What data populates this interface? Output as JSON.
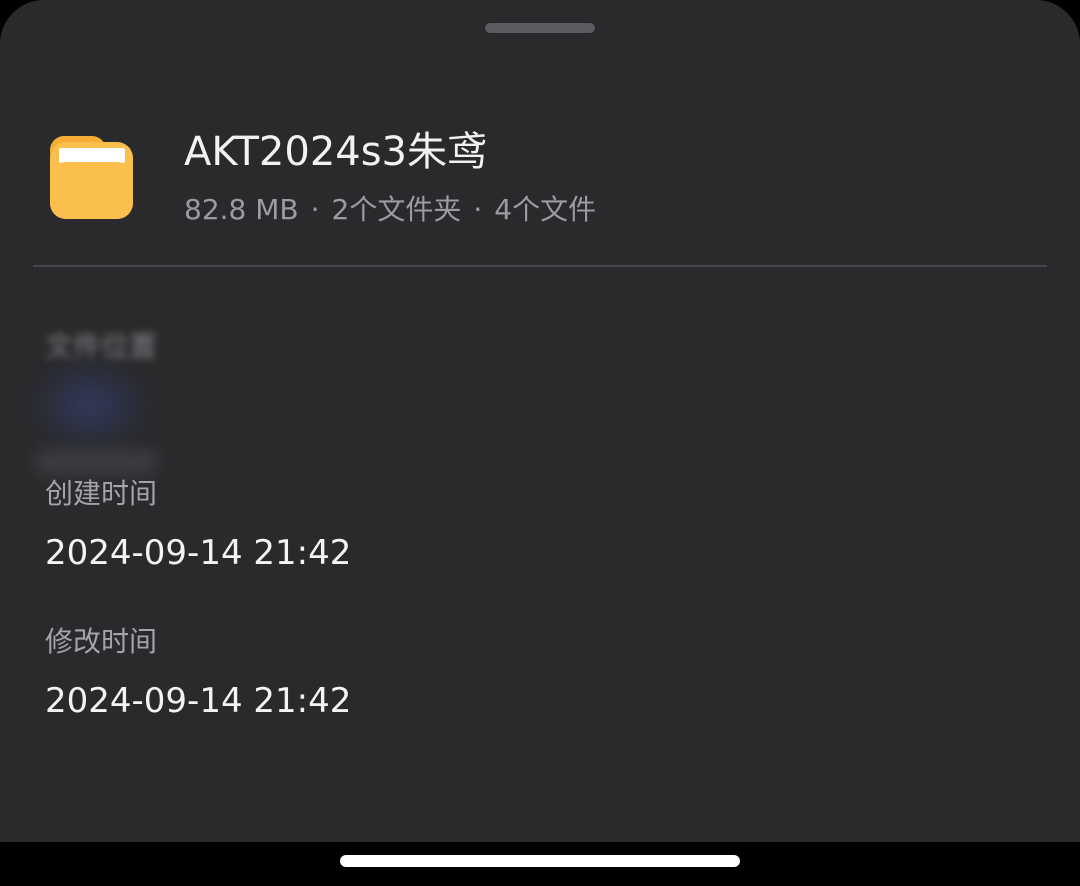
{
  "folder": {
    "name": "AKT2024s3朱鸢",
    "size": "82.8 MB",
    "folders_count": "2个文件夹",
    "files_count": "4个文件",
    "separator": "·",
    "icon": "folder-icon",
    "icon_color": "#fbbf4e"
  },
  "details": {
    "location_label": "文件位置",
    "created_label": "创建时间",
    "created_value": "2024-09-14 21:42",
    "modified_label": "修改时间",
    "modified_value": "2024-09-14 21:42"
  },
  "colors": {
    "sheet_background": "#2a2a2c",
    "primary_text": "#f4f4f4",
    "secondary_text": "#9b9ba0"
  }
}
